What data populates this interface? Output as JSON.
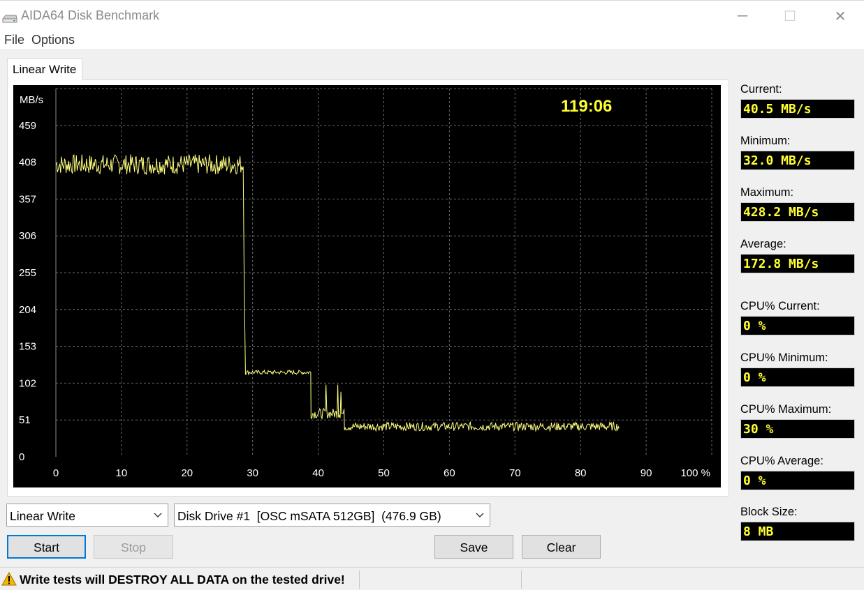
{
  "window": {
    "title": "AIDA64 Disk Benchmark",
    "icon": "disk-drive-icon",
    "controls": {
      "minimize": "─",
      "maximize": "☐",
      "close": "✕"
    }
  },
  "menu": [
    "File",
    "Options"
  ],
  "tab": {
    "label": "Linear Write"
  },
  "chart": {
    "timer": "119:06",
    "line_color": "#ffff80",
    "timer_color": "#ffff33"
  },
  "chart_data": {
    "type": "line",
    "title": "",
    "ylabel": "MB/s",
    "xlabel": "",
    "y_ticks": [
      "459",
      "408",
      "357",
      "306",
      "255",
      "204",
      "153",
      "102",
      "51",
      "0"
    ],
    "x_ticks": [
      "0",
      "10",
      "20",
      "30",
      "40",
      "50",
      "60",
      "70",
      "80",
      "90",
      "100 %"
    ],
    "xlim": [
      0,
      100
    ],
    "ylim": [
      0,
      510
    ],
    "grid": true,
    "series": [
      {
        "segments": [
          {
            "x_start": 0,
            "x_end": 28.6,
            "mean": 405,
            "jitter": 14
          },
          {
            "x_start": 28.6,
            "x_end": 28.7,
            "drop_to": 255
          },
          {
            "x_start": 28.7,
            "x_end": 28.9,
            "drop_to": 115
          },
          {
            "x_start": 28.9,
            "x_end": 38.9,
            "mean": 117,
            "jitter": 3
          },
          {
            "x_start": 38.9,
            "x_end": 44.0,
            "mean": 60,
            "jitter": 7,
            "spikes": [
              {
                "x": 41.2,
                "y": 100
              },
              {
                "x": 43.0,
                "y": 100
              },
              {
                "x": 43.5,
                "y": 90
              }
            ]
          },
          {
            "x_start": 44.0,
            "x_end": 86.0,
            "mean": 42,
            "jitter": 6
          }
        ]
      }
    ]
  },
  "stats": [
    {
      "label": "Current:",
      "value": "40.5 MB/s"
    },
    {
      "label": "Minimum:",
      "value": "32.0 MB/s"
    },
    {
      "label": "Maximum:",
      "value": "428.2 MB/s"
    },
    {
      "label": "Average:",
      "value": "172.8 MB/s"
    },
    {
      "label": "CPU% Current:",
      "value": "0 %"
    },
    {
      "label": "CPU% Minimum:",
      "value": "0 %"
    },
    {
      "label": "CPU% Maximum:",
      "value": "30 %"
    },
    {
      "label": "CPU% Average:",
      "value": "0 %"
    },
    {
      "label": "Block Size:",
      "value": "8 MB"
    }
  ],
  "controls": {
    "test_select": "Linear Write",
    "drive_select": "Disk Drive #1  [OSC mSATA 512GB]  (476.9 GB)",
    "start": "Start",
    "stop": "Stop",
    "save": "Save",
    "clear": "Clear"
  },
  "status": {
    "warning": "Write tests will DESTROY ALL DATA on the tested drive!"
  }
}
